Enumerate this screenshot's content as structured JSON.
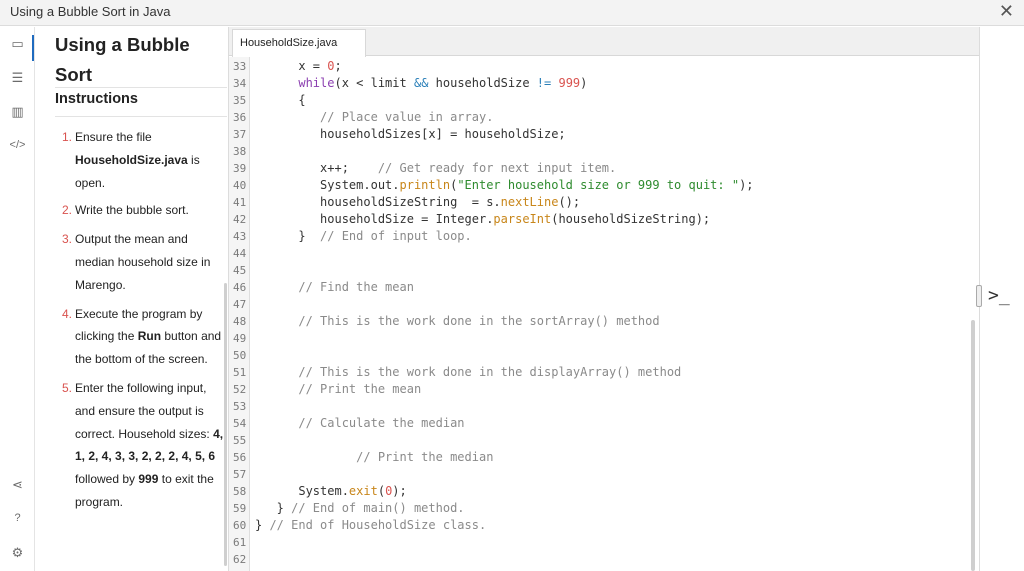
{
  "window": {
    "title": "Using a Bubble Sort in Java",
    "close_glyph": "✕"
  },
  "rail": {
    "items": [
      {
        "icon": "book-icon",
        "glyph": "▭"
      },
      {
        "icon": "list-icon",
        "glyph": "☰"
      },
      {
        "icon": "chart-icon",
        "glyph": "▥"
      },
      {
        "icon": "code-icon",
        "glyph": "</>"
      },
      {
        "icon": "share-icon",
        "glyph": "⋖"
      },
      {
        "icon": "help-icon",
        "glyph": "?"
      },
      {
        "icon": "settings-icon",
        "glyph": "⚙"
      }
    ]
  },
  "instructions": {
    "title": "Using a Bubble Sort",
    "heading": "Instructions",
    "steps": [
      {
        "num": "1.",
        "pre": "Ensure the file ",
        "bold": "HouseholdSize.java",
        "post": " is open."
      },
      {
        "num": "2.",
        "pre": "Write the bubble sort.",
        "bold": "",
        "post": ""
      },
      {
        "num": "3.",
        "pre": "Output the mean and median household size in Marengo.",
        "bold": "",
        "post": ""
      },
      {
        "num": "4.",
        "pre": "Execute the program by clicking the ",
        "bold": "Run",
        "post": " button and the bottom of the screen."
      },
      {
        "num": "5.",
        "pre": "Enter the following input, and ensure the output is correct. Household sizes: ",
        "bold": "4, 1, 2, 4, 3, 3, 2, 2, 2, 4, 5, 6",
        "post": " followed by ",
        "bold2": "999",
        "post2": " to exit the program."
      }
    ]
  },
  "editor": {
    "tab_label": "HouseholdSize.java",
    "terminal_glyph": ">_",
    "lines": [
      {
        "n": "33",
        "html": "      x = <span class=\"num\">0</span>;"
      },
      {
        "n": "34",
        "html": "      <span class=\"kw\">while</span>(x &lt; limit <span class=\"op\">&amp;&amp;</span> householdSize <span class=\"op\">!=</span> <span class=\"num\">999</span>)"
      },
      {
        "n": "35",
        "html": "      {"
      },
      {
        "n": "36",
        "html": "         <span class=\"cm\">// Place value in array.</span>"
      },
      {
        "n": "37",
        "html": "         householdSizes[x] = householdSize;"
      },
      {
        "n": "38",
        "html": ""
      },
      {
        "n": "39",
        "html": "         x++;    <span class=\"cm\">// Get ready for next input item.</span>"
      },
      {
        "n": "40",
        "html": "         System.out.<span class=\"mth\">println</span>(<span class=\"str\">\"Enter household size or 999 to quit: \"</span>);"
      },
      {
        "n": "41",
        "html": "         householdSizeString  = s.<span class=\"mth\">nextLine</span>();"
      },
      {
        "n": "42",
        "html": "         householdSize = Integer.<span class=\"mth\">parseInt</span>(householdSizeString);"
      },
      {
        "n": "43",
        "html": "      }  <span class=\"cm\">// End of input loop.</span>"
      },
      {
        "n": "44",
        "html": ""
      },
      {
        "n": "45",
        "html": ""
      },
      {
        "n": "46",
        "html": "      <span class=\"cm\">// Find the mean</span>"
      },
      {
        "n": "47",
        "html": ""
      },
      {
        "n": "48",
        "html": "      <span class=\"cm\">// This is the work done in the sortArray() method</span>"
      },
      {
        "n": "49",
        "html": ""
      },
      {
        "n": "50",
        "html": ""
      },
      {
        "n": "51",
        "html": "      <span class=\"cm\">// This is the work done in the displayArray() method</span>"
      },
      {
        "n": "52",
        "html": "      <span class=\"cm\">// Print the mean</span>"
      },
      {
        "n": "53",
        "html": ""
      },
      {
        "n": "54",
        "html": "      <span class=\"cm\">// Calculate the median</span>"
      },
      {
        "n": "55",
        "html": ""
      },
      {
        "n": "56",
        "html": "              <span class=\"cm\">// Print the median</span>"
      },
      {
        "n": "57",
        "html": ""
      },
      {
        "n": "58",
        "html": "      System.<span class=\"mth\">exit</span>(<span class=\"num\">0</span>);"
      },
      {
        "n": "59",
        "html": "   } <span class=\"cm\">// End of main() method.</span>"
      },
      {
        "n": "60",
        "html": "} <span class=\"cm\">// End of HouseholdSize class.</span>"
      },
      {
        "n": "61",
        "html": ""
      },
      {
        "n": "62",
        "html": ""
      }
    ]
  },
  "colors": {
    "accent": "#1f6bbf",
    "keyword": "#8b3fb0",
    "comment": "#8a8a8a",
    "number": "#d9534f",
    "string": "#2e8b2e",
    "method": "#c8861a"
  }
}
